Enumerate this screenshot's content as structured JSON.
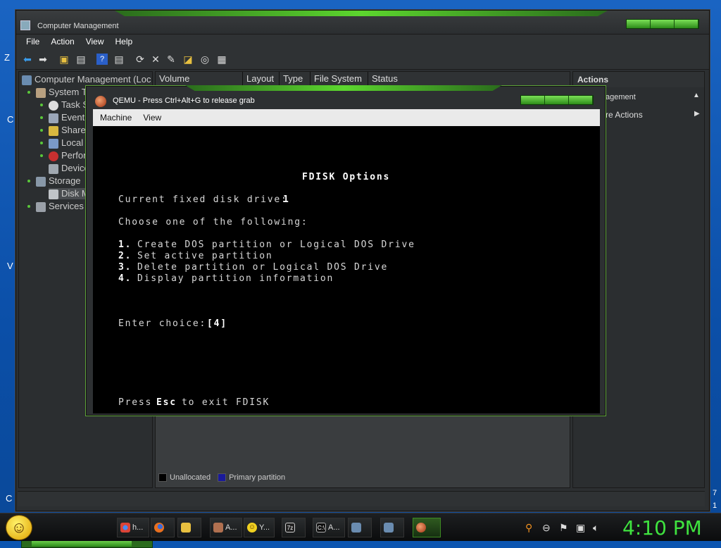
{
  "desktop": {
    "edge_labels": [
      "Z",
      "C",
      "V",
      "C"
    ],
    "edge_right": [
      "7",
      "1"
    ]
  },
  "cm": {
    "title": "Computer Management",
    "menu": [
      "File",
      "Action",
      "View",
      "Help"
    ],
    "tree": {
      "root": "Computer Management (Loc",
      "items": [
        {
          "label": "System T",
          "icon": "tools-icon"
        },
        {
          "label": "Task S",
          "icon": "clock-icon"
        },
        {
          "label": "Event",
          "icon": "event-viewer-icon"
        },
        {
          "label": "Share",
          "icon": "shared-folder-icon"
        },
        {
          "label": "Local",
          "icon": "users-icon"
        },
        {
          "label": "Perfor",
          "icon": "performance-icon"
        },
        {
          "label": "Device",
          "icon": "device-manager-icon"
        },
        {
          "label": "Storage",
          "icon": "storage-icon"
        },
        {
          "label": "Disk M",
          "icon": "disk-icon"
        },
        {
          "label": "Services",
          "icon": "services-icon"
        }
      ]
    },
    "columns": [
      "Volume",
      "Layout",
      "Type",
      "File System",
      "Status"
    ],
    "legend": {
      "unallocated": "Unallocated",
      "primary": "Primary partition"
    },
    "actions": {
      "header": "Actions",
      "items": [
        "agement",
        "re Actions"
      ]
    }
  },
  "qemu": {
    "title": "QEMU - Press Ctrl+Alt+G to release grab",
    "menu": [
      "Machine",
      "View"
    ],
    "screen": {
      "heading": "FDISK Options",
      "current_drive_label": "Current fixed disk drive:",
      "current_drive_value": "1",
      "prompt": "Choose one of the following:",
      "options": [
        {
          "num": "1.",
          "text": "Create DOS partition or Logical DOS Drive"
        },
        {
          "num": "2.",
          "text": "Set active partition"
        },
        {
          "num": "3.",
          "text": "Delete partition or Logical DOS Drive"
        },
        {
          "num": "4.",
          "text": "Display partition information"
        }
      ],
      "choice_label": "Enter choice:",
      "choice_value": "[4]",
      "exit_press": "Press",
      "exit_key": "Esc",
      "exit_rest": "to exit FDISK"
    }
  },
  "taskbar": {
    "tasks": [
      {
        "label": "h...",
        "icon": "chrome-icon"
      },
      {
        "label": "",
        "icon": "firefox-icon"
      },
      {
        "label": "",
        "icon": "explorer-icon"
      },
      {
        "label": "A...",
        "icon": "app-icon"
      },
      {
        "label": "Y...",
        "icon": "yahoo-messenger-icon"
      },
      {
        "label": "",
        "icon": "7zip-icon"
      },
      {
        "label": "A...",
        "icon": "cmd-icon"
      },
      {
        "label": "",
        "icon": "computer-management-icon"
      },
      {
        "label": "",
        "icon": "computer-management-icon"
      },
      {
        "label": "",
        "icon": "qemu-icon"
      }
    ],
    "clock": "4:10 PM"
  }
}
